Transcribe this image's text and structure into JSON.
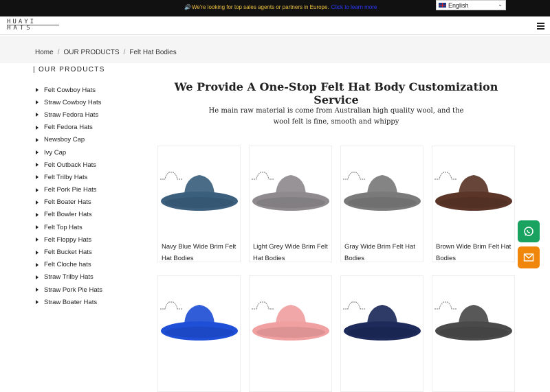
{
  "announcement": {
    "icon": "speaker-icon",
    "text": "We're looking for top sales agents or partners in Europe.",
    "link": "Click to learn more"
  },
  "language": {
    "label": "English",
    "flag": "uk-flag-icon"
  },
  "logo": {
    "line1": "HUAYI",
    "line2": "HATS"
  },
  "breadcrumb": [
    "Home",
    "OUR PRODUCTS",
    "Felt Hat Bodies"
  ],
  "sidebar": {
    "title": "| OUR PRODUCTS",
    "items": [
      "Felt Cowboy Hats",
      "Straw Cowboy Hats",
      "Straw Fedora Hats",
      "Felt Fedora Hats",
      "Newsboy Cap",
      "Ivy Cap",
      "Felt Outback Hats",
      "Felt Trilby Hats",
      "Felt Pork Pie Hats",
      "Felt Boater Hats",
      "Felt Bowler Hats",
      "Felt Top Hats",
      "Felt Floppy Hats",
      "Felt Bucket Hats",
      "Felt Cloche hats",
      "Straw Trilby Hats",
      "Straw Pork Pie Hats",
      "Straw Boater Hats"
    ]
  },
  "main": {
    "title": "We Provide A One-Stop Felt Hat Body Customization Service",
    "subtitle": "He main raw material is come from Australian high quality wool, and the wool felt is fine, smooth and whippy"
  },
  "products": [
    {
      "name": "Navy Blue Wide Brim Felt Hat Bodies",
      "color": "#3b5f7d"
    },
    {
      "name": "Light Grey Wide Brim Felt Hat Bodies",
      "color": "#8e8a8e"
    },
    {
      "name": "Gray Wide Brim Felt Hat Bodies",
      "color": "#7a7a7a"
    },
    {
      "name": "Brown Wide Brim Felt Hat Bodies",
      "color": "#5a3528"
    },
    {
      "name": "",
      "color": "#1f4fd6"
    },
    {
      "name": "",
      "color": "#f0a0a0"
    },
    {
      "name": "",
      "color": "#1d2a5a"
    },
    {
      "name": "",
      "color": "#4a4a4a"
    }
  ],
  "floating": {
    "whatsapp": "whatsapp-icon",
    "email": "email-icon"
  },
  "colors": {
    "topbar": "#111111",
    "announce": "#f0c040",
    "link": "#2a3cff",
    "whatsapp": "#1aa260",
    "email": "#f0860a"
  }
}
